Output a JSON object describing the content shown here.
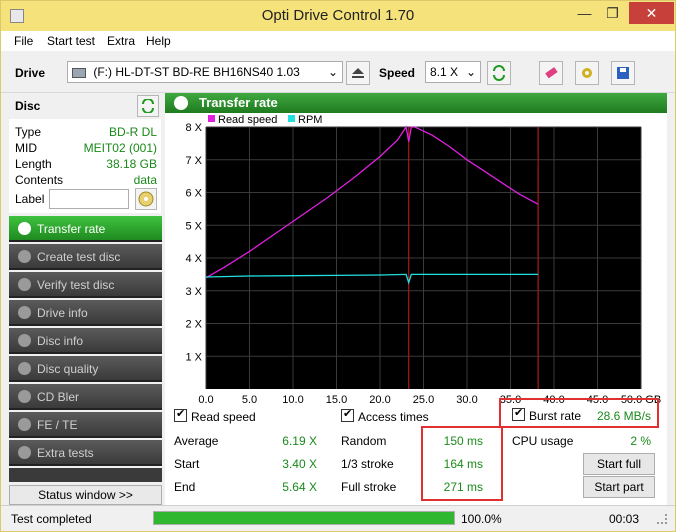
{
  "window": {
    "title": "Opti Drive Control 1.70",
    "minimize": "—",
    "restore": "❐",
    "close": "✕"
  },
  "menu": [
    "File",
    "Start test",
    "Extra",
    "Help"
  ],
  "toolbar": {
    "drive_label": "Drive",
    "drive_value": "(F:)  HL-DT-ST BD-RE  BH16NS40 1.03",
    "speed_label": "Speed",
    "speed_value": "8.1 X"
  },
  "disc": {
    "header": "Disc",
    "rows": [
      {
        "label": "Type",
        "value": "BD-R DL"
      },
      {
        "label": "MID",
        "value": "MEIT02 (001)"
      },
      {
        "label": "Length",
        "value": "38.18 GB"
      },
      {
        "label": "Contents",
        "value": "data"
      }
    ],
    "label_field": "Label",
    "label_value": ""
  },
  "nav": [
    {
      "label": "Transfer rate",
      "active": true
    },
    {
      "label": "Create test disc",
      "active": false
    },
    {
      "label": "Verify test disc",
      "active": false
    },
    {
      "label": "Drive info",
      "active": false
    },
    {
      "label": "Disc info",
      "active": false
    },
    {
      "label": "Disc quality",
      "active": false
    },
    {
      "label": "CD Bler",
      "active": false
    },
    {
      "label": "FE / TE",
      "active": false
    },
    {
      "label": "Extra tests",
      "active": false
    }
  ],
  "status_window_button": "Status window >>",
  "panel_title": "Transfer rate",
  "chart_data": {
    "type": "line",
    "legend": [
      "Read speed",
      "RPM"
    ],
    "legend_colors": [
      "#e020e0",
      "#20e0e0"
    ],
    "x_ticks": [
      "0.0",
      "5.0",
      "10.0",
      "15.0",
      "20.0",
      "25.0",
      "30.0",
      "35.0",
      "40.0",
      "45.0",
      "50.0 GB"
    ],
    "y_ticks": [
      "1 X",
      "2 X",
      "3 X",
      "4 X",
      "5 X",
      "6 X",
      "7 X",
      "8 X"
    ],
    "xlim": [
      0,
      50
    ],
    "ylim": [
      0,
      8
    ],
    "series": [
      {
        "name": "Read speed",
        "color": "#e020e0",
        "x": [
          0,
          2,
          5,
          8,
          11,
          14,
          17,
          20,
          22,
          23.0,
          23.3,
          23.6,
          24,
          26,
          28,
          30,
          32,
          34,
          36,
          38.18
        ],
        "y": [
          3.4,
          3.7,
          4.2,
          4.75,
          5.3,
          5.85,
          6.45,
          7.1,
          7.6,
          8.0,
          7.55,
          8.0,
          8.0,
          7.75,
          7.4,
          7.0,
          6.65,
          6.3,
          5.95,
          5.64
        ]
      },
      {
        "name": "RPM",
        "color": "#20e0e0",
        "x": [
          0,
          5,
          10,
          15,
          20,
          23.0,
          23.3,
          23.6,
          25,
          30,
          35,
          38.18
        ],
        "y": [
          3.42,
          3.45,
          3.46,
          3.47,
          3.48,
          3.5,
          3.25,
          3.5,
          3.5,
          3.5,
          3.5,
          3.5
        ]
      }
    ],
    "markers_x": [
      23.3,
      38.18
    ],
    "grid": true
  },
  "stats": {
    "read_speed_label": "Read speed",
    "access_times_label": "Access times",
    "burst_rate_label": "Burst rate",
    "burst_rate_value": "28.6 MB/s",
    "average_label": "Average",
    "average_value": "6.19 X",
    "start_label": "Start",
    "start_value": "3.40 X",
    "end_label": "End",
    "end_value": "5.64 X",
    "random_label": "Random",
    "random_value": "150 ms",
    "third_label": "1/3 stroke",
    "third_value": "164 ms",
    "full_label": "Full stroke",
    "full_value": "271 ms",
    "cpu_label": "CPU usage",
    "cpu_value": "2 %",
    "start_full_button": "Start full",
    "start_part_button": "Start part"
  },
  "statusbar": {
    "text": "Test completed",
    "progress": 1.0,
    "progress_text": "100.0%",
    "time": "00:03"
  },
  "colors": {
    "accent_green": "#1f8a1f",
    "value_green": "#1a8a1a",
    "highlight_red": "#e03030"
  }
}
